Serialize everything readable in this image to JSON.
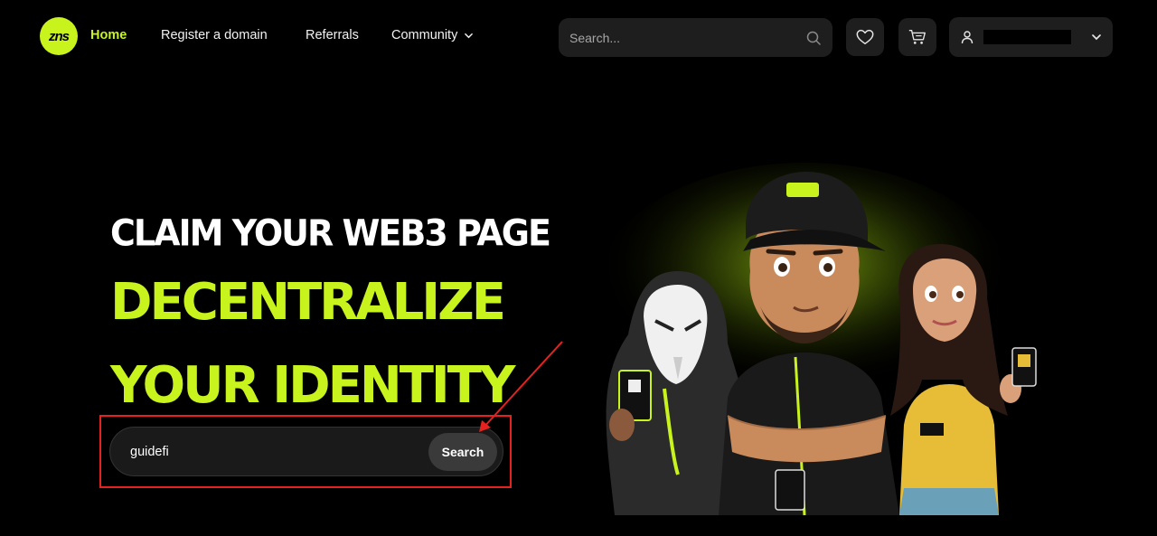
{
  "nav": {
    "logo_text": "zns",
    "links": [
      "Home",
      "Register a domain",
      "Referrals",
      "Community"
    ],
    "search_placeholder": "Search..."
  },
  "hero": {
    "line1": "CLAIM YOUR WEB3 PAGE",
    "line2": "DECENTRALIZE",
    "line3": "YOUR IDENTITY"
  },
  "domain_search": {
    "value": "guidefi",
    "button": "Search"
  },
  "colors": {
    "accent": "#c8f31d",
    "background": "#000000",
    "annotation": "#e5221f"
  },
  "icons": [
    "search-icon",
    "heart-icon",
    "cart-icon",
    "user-icon",
    "chevron-down-icon"
  ]
}
